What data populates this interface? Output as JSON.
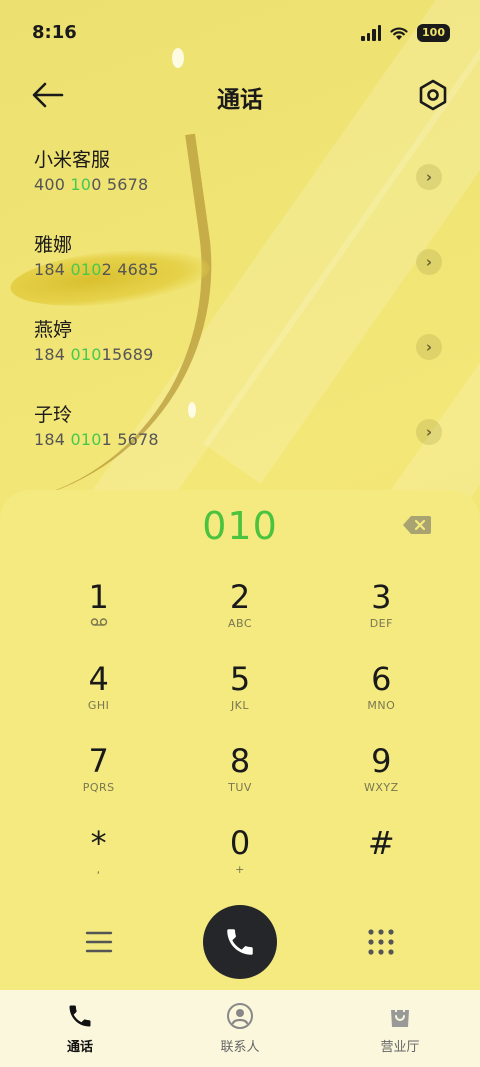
{
  "status_bar": {
    "time": "8:16",
    "battery": "100"
  },
  "header": {
    "title": "通话"
  },
  "contacts": [
    {
      "name": "小米客服",
      "number_parts": [
        "400",
        "",
        " 10",
        "0 5678"
      ]
    },
    {
      "name": "雅娜",
      "number_parts": [
        "184 ",
        "0",
        "10",
        "2 4685"
      ]
    },
    {
      "name": "燕婷",
      "number_parts": [
        "184 ",
        "0",
        "10",
        "15689"
      ]
    },
    {
      "name": "子玲",
      "number_parts": [
        "184 ",
        "0",
        "10",
        "1 5678"
      ]
    }
  ],
  "dialer": {
    "input": "010",
    "keys": [
      {
        "digit": "1",
        "letters": ""
      },
      {
        "digit": "2",
        "letters": "ABC"
      },
      {
        "digit": "3",
        "letters": "DEF"
      },
      {
        "digit": "4",
        "letters": "GHI"
      },
      {
        "digit": "5",
        "letters": "JKL"
      },
      {
        "digit": "6",
        "letters": "MNO"
      },
      {
        "digit": "7",
        "letters": "PQRS"
      },
      {
        "digit": "8",
        "letters": "TUV"
      },
      {
        "digit": "9",
        "letters": "WXYZ"
      },
      {
        "digit": "*",
        "letters": ","
      },
      {
        "digit": "0",
        "letters": "+"
      },
      {
        "digit": "#",
        "letters": ""
      }
    ]
  },
  "tabs": [
    {
      "label": "通话",
      "icon": "phone-icon",
      "active": true
    },
    {
      "label": "联系人",
      "icon": "contact-icon",
      "active": false
    },
    {
      "label": "营业厅",
      "icon": "bag-icon",
      "active": false
    }
  ],
  "colors": {
    "highlight": "#46c94d",
    "accent_text": "#4cc33e",
    "call_button": "#25262a"
  }
}
